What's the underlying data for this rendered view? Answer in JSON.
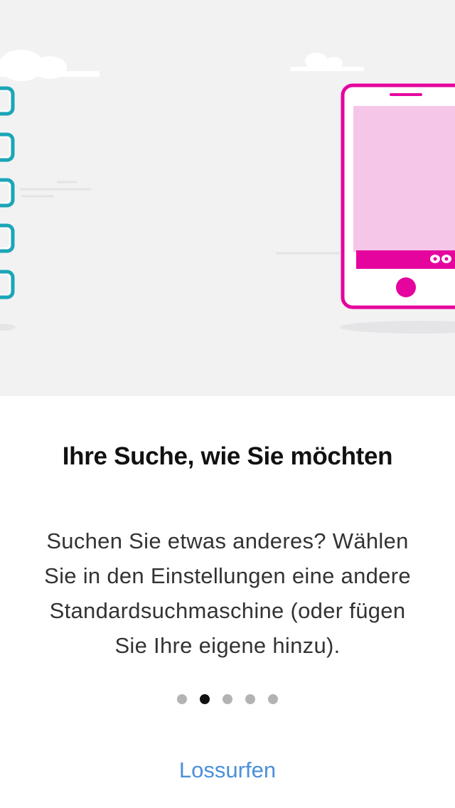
{
  "onboarding": {
    "title": "Ihre Suche, wie Sie möchten",
    "description": "Suchen Sie etwas anderes? Wählen Sie in den Einstellungen eine andere Standardsuchmaschine (oder fügen Sie Ihre eigene hinzu).",
    "cta_label": "Lossurfen",
    "page_count": 5,
    "active_page": 2
  },
  "colors": {
    "illustration_bg": "#f2f2f3",
    "accent_teal": "#1aa6b7",
    "accent_magenta": "#e5049e",
    "phone_screen": "#f5c6e8",
    "link_blue": "#4a90d9"
  }
}
